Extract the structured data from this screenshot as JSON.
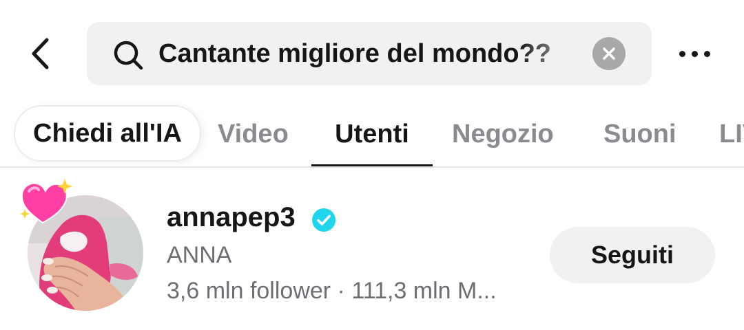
{
  "search": {
    "query": "Cantante migliore del mondo??"
  },
  "tabs": [
    {
      "label": "Chiedi all'IA"
    },
    {
      "label": "Video"
    },
    {
      "label": "Utenti"
    },
    {
      "label": "Negozio"
    },
    {
      "label": "Suoni"
    },
    {
      "label": "LIVE"
    }
  ],
  "active_tab": "Utenti",
  "user": {
    "username": "annapep3",
    "display_name": "ANNA",
    "followers": "3,6 mln follower",
    "separator": " · ",
    "likes": "111,3 mln M...",
    "follow_button_label": "Seguiti",
    "verified": true
  },
  "icons": {
    "back": "chevron-left-icon",
    "search": "magnifier-icon",
    "clear": "close-circle-icon",
    "more": "more-horizontal-icon",
    "verified": "verified-badge-icon",
    "avatar_sticker": "sparkling-heart-icon"
  },
  "colors": {
    "verified": "#20d5ec",
    "search_bg": "#f1f1f2",
    "active_tab": "#161616",
    "inactive_tab": "#8a8b91",
    "secondary_text": "#6d6e73",
    "heart": "#ff3fa4"
  }
}
